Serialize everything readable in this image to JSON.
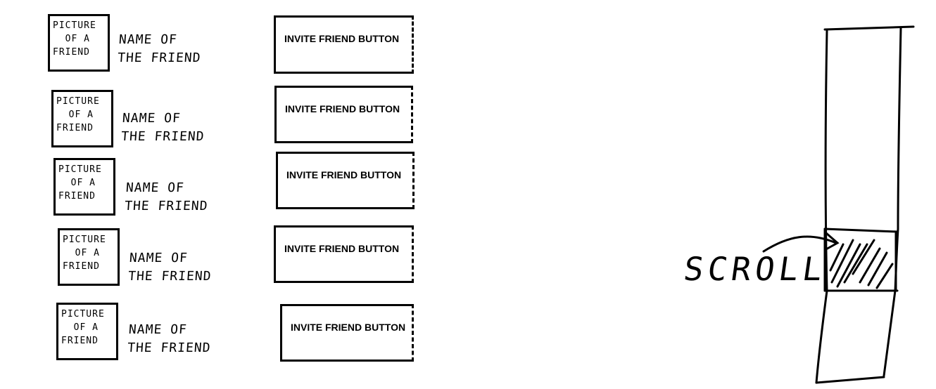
{
  "friends": [
    {
      "avatar_label": "PICTURE\n  OF A\nFRIEND",
      "name": "NAME OF\nTHE FRIEND",
      "invite_label": "INVITE FRIEND BUTTON"
    },
    {
      "avatar_label": "PICTURE\n  OF A\nFRIEND",
      "name": "NAME OF\nTHE FRIEND",
      "invite_label": "INVITE FRIEND BUTTON"
    },
    {
      "avatar_label": "PICTURE\n  OF A\nFRIEND",
      "name": "NAME OF\nTHE FRIEND",
      "invite_label": "INVITE FRIEND BUTTON"
    },
    {
      "avatar_label": "PICTURE\n  OF A\nFRIEND",
      "name": "NAME OF\nTHE FRIEND",
      "invite_label": "INVITE FRIEND BUTTON"
    },
    {
      "avatar_label": "PICTURE\n  OF A\nFRIEND",
      "name": "NAME OF\nTHE FRIEND",
      "invite_label": "INVITE FRIEND BUTTON"
    }
  ],
  "scrollbar": {
    "label": "SCROLL"
  }
}
